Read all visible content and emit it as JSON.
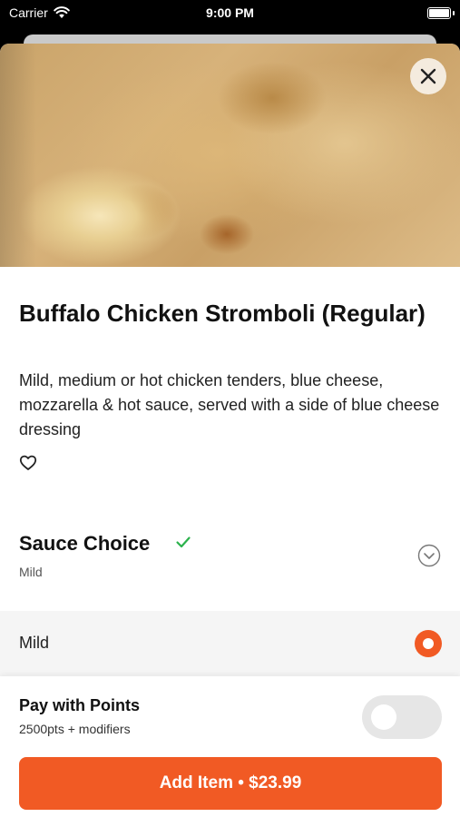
{
  "status_bar": {
    "carrier": "Carrier",
    "time": "9:00 PM",
    "icons": [
      "wifi-icon",
      "battery-icon"
    ]
  },
  "item": {
    "title": "Buffalo Chicken Stromboli (Regular)",
    "description": "Mild, medium or hot chicken tenders, blue cheese, mozzarella & hot sauce, served with a side of blue cheese dressing",
    "image": "stromboli-photo",
    "favorite_icon": "heart-outline-icon",
    "close_icon": "close-icon"
  },
  "sauce_section": {
    "title": "Sauce Choice",
    "selected_summary": "Mild",
    "status_icon": "checkmark-icon",
    "status_color": "#2bb24c",
    "expand_icon": "chevron-down-icon",
    "options": [
      {
        "label": "Mild",
        "selected": true
      }
    ]
  },
  "points": {
    "title": "Pay with Points",
    "subtitle": "2500pts + modifiers",
    "enabled": false
  },
  "add_button": {
    "label": "Add Item • $23.99"
  },
  "colors": {
    "accent": "#f15a24",
    "toggle_off": "#e6e6e6",
    "option_bg": "#f5f5f5"
  }
}
